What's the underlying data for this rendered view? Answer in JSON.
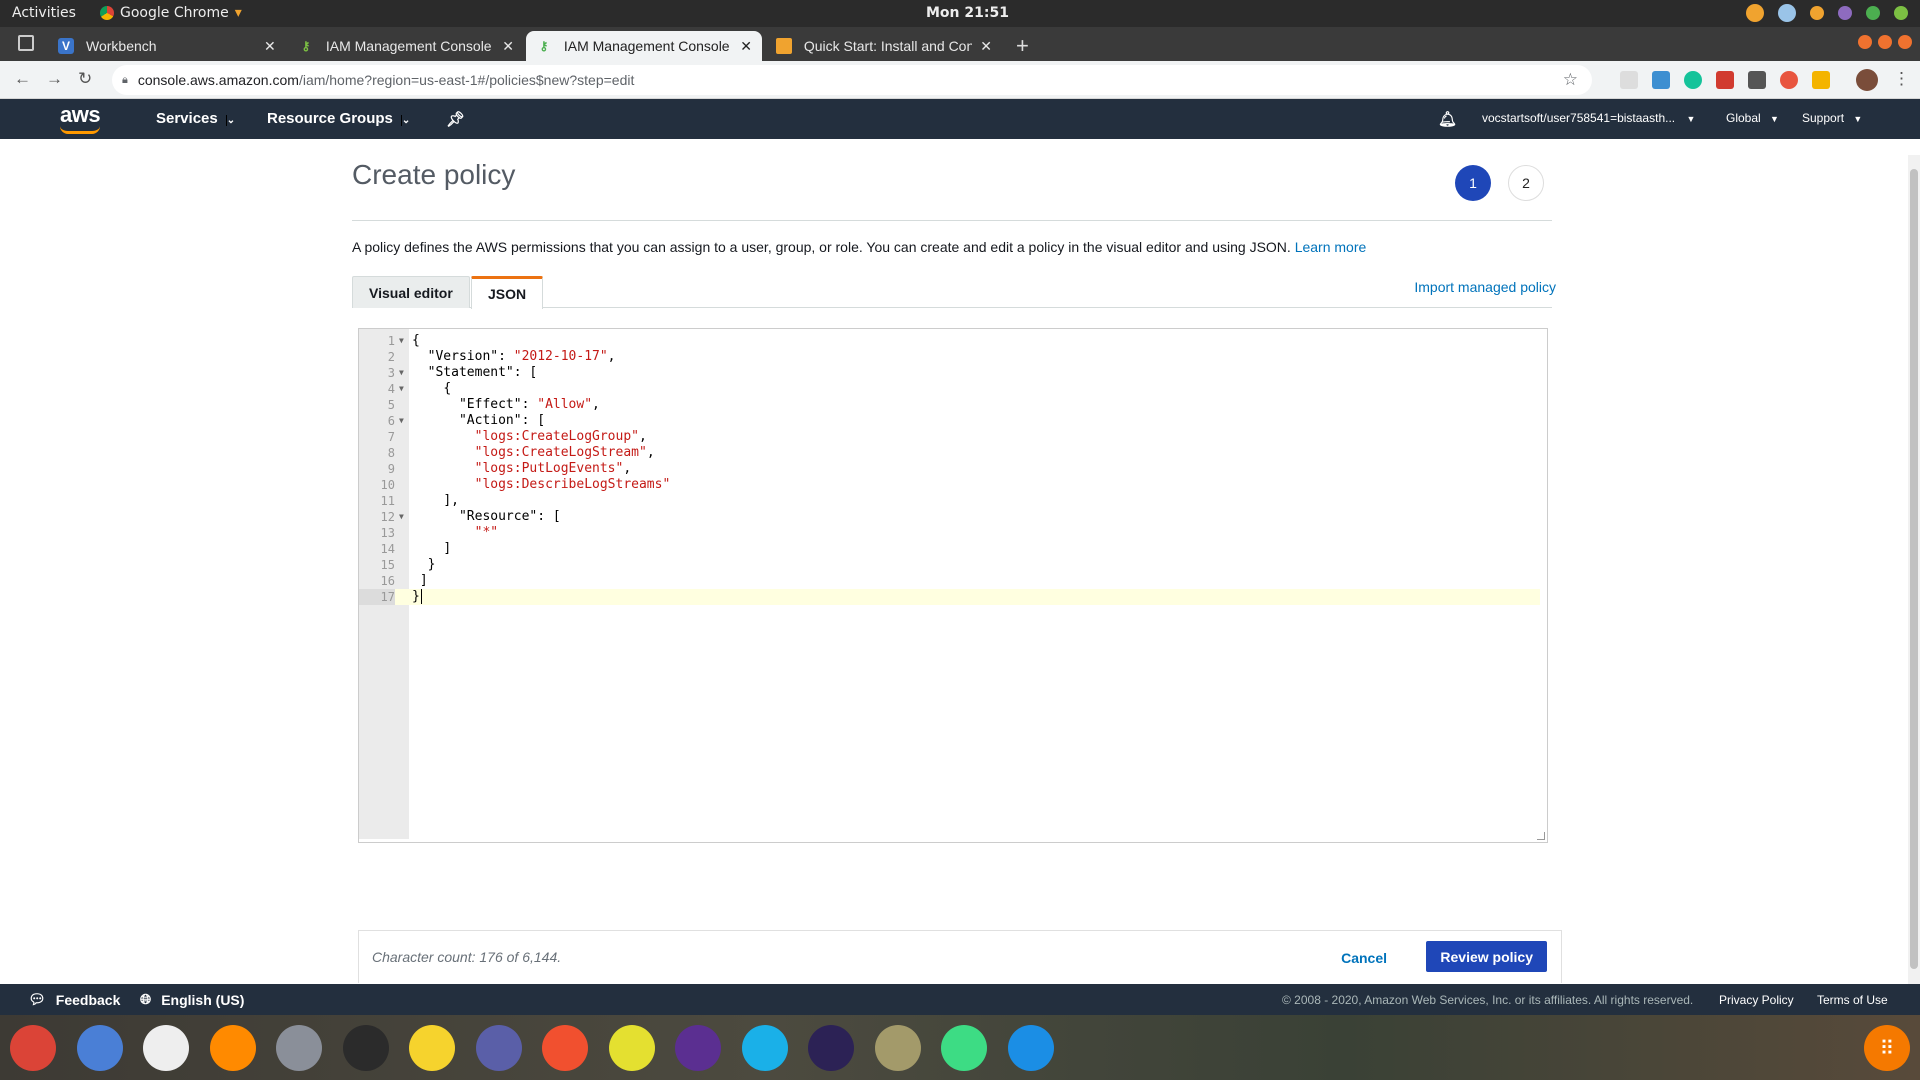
{
  "system": {
    "activities": "Activities",
    "app_name": "Google Chrome",
    "clock": "Mon 21:51"
  },
  "browser": {
    "tabs": [
      {
        "label": "Workbench",
        "favicon": "V"
      },
      {
        "label": "IAM Management Console",
        "favicon": "key"
      },
      {
        "label": "IAM Management Console",
        "favicon": "key"
      },
      {
        "label": "Quick Start: Install and Configure",
        "favicon": "box"
      }
    ],
    "url_host": "console.aws.amazon.com",
    "url_path": "/iam/home?region=us-east-1#/policies$new?step=edit"
  },
  "aws_nav": {
    "logo": "aws",
    "services": "Services",
    "resource_groups": "Resource Groups",
    "account": "vocstartsoft/user758541=bistaasth...",
    "region": "Global",
    "support": "Support"
  },
  "page": {
    "title": "Create policy",
    "steps": [
      "1",
      "2"
    ],
    "intro_text": "A policy defines the AWS permissions that you can assign to a user, group, or role. You can create and edit a policy in the visual editor and using JSON.",
    "learn_more": "Learn more",
    "tabs": {
      "visual_editor": "Visual editor",
      "json": "JSON"
    },
    "import_link": "Import managed policy"
  },
  "editor": {
    "lines": [
      {
        "n": "1",
        "fold": true,
        "indent": "",
        "parts": [
          [
            "p",
            "{"
          ]
        ]
      },
      {
        "n": "2",
        "fold": false,
        "indent": "  ",
        "parts": [
          [
            "p",
            "\"Version\": "
          ],
          [
            "s",
            "\"2012-10-17\""
          ],
          [
            "p",
            ","
          ]
        ]
      },
      {
        "n": "3",
        "fold": true,
        "indent": "  ",
        "parts": [
          [
            "p",
            "\"Statement\": ["
          ]
        ]
      },
      {
        "n": "4",
        "fold": true,
        "indent": "    ",
        "parts": [
          [
            "p",
            "{"
          ]
        ]
      },
      {
        "n": "5",
        "fold": false,
        "indent": "      ",
        "parts": [
          [
            "p",
            "\"Effect\": "
          ],
          [
            "s",
            "\"Allow\""
          ],
          [
            "p",
            ","
          ]
        ]
      },
      {
        "n": "6",
        "fold": true,
        "indent": "      ",
        "parts": [
          [
            "p",
            "\"Action\": ["
          ]
        ]
      },
      {
        "n": "7",
        "fold": false,
        "indent": "        ",
        "parts": [
          [
            "s",
            "\"logs:CreateLogGroup\""
          ],
          [
            "p",
            ","
          ]
        ]
      },
      {
        "n": "8",
        "fold": false,
        "indent": "        ",
        "parts": [
          [
            "s",
            "\"logs:CreateLogStream\""
          ],
          [
            "p",
            ","
          ]
        ]
      },
      {
        "n": "9",
        "fold": false,
        "indent": "        ",
        "parts": [
          [
            "s",
            "\"logs:PutLogEvents\""
          ],
          [
            "p",
            ","
          ]
        ]
      },
      {
        "n": "10",
        "fold": false,
        "indent": "        ",
        "parts": [
          [
            "s",
            "\"logs:DescribeLogStreams\""
          ]
        ]
      },
      {
        "n": "11",
        "fold": false,
        "indent": "    ",
        "parts": [
          [
            "p",
            "],"
          ]
        ]
      },
      {
        "n": "12",
        "fold": true,
        "indent": "      ",
        "parts": [
          [
            "p",
            "\"Resource\": ["
          ]
        ]
      },
      {
        "n": "13",
        "fold": false,
        "indent": "        ",
        "parts": [
          [
            "s",
            "\"*\""
          ]
        ]
      },
      {
        "n": "14",
        "fold": false,
        "indent": "    ",
        "parts": [
          [
            "p",
            "]"
          ]
        ]
      },
      {
        "n": "15",
        "fold": false,
        "indent": "  ",
        "parts": [
          [
            "p",
            "}"
          ]
        ]
      },
      {
        "n": "16",
        "fold": false,
        "indent": " ",
        "parts": [
          [
            "p",
            "]"
          ]
        ]
      },
      {
        "n": "17",
        "fold": false,
        "indent": "",
        "parts": [
          [
            "p",
            "}"
          ]
        ]
      }
    ],
    "active_line": 17
  },
  "footer_actions": {
    "char_count": "Character count: 176 of 6,144.",
    "cancel": "Cancel",
    "review": "Review policy"
  },
  "aws_footer": {
    "feedback": "Feedback",
    "language": "English (US)",
    "copyright": "© 2008 - 2020, Amazon Web Services, Inc. or its affiliates. All rights reserved.",
    "privacy": "Privacy Policy",
    "terms": "Terms of Use"
  },
  "colors": {
    "aws_navy": "#232f3e",
    "aws_orange": "#ff9900",
    "primary_blue": "#1f47b8",
    "link_blue": "#0073bb",
    "json_string": "#c41a16"
  },
  "dock": [
    {
      "name": "chrome-icon",
      "color": "#db4437"
    },
    {
      "name": "chromium-icon",
      "color": "#4a7fd6"
    },
    {
      "name": "calendar-icon",
      "color": "#eeeeee"
    },
    {
      "name": "firefox-icon",
      "color": "#ff8a00"
    },
    {
      "name": "files-icon",
      "color": "#8a8f99"
    },
    {
      "name": "terminal-icon",
      "color": "#2b2b2b"
    },
    {
      "name": "music-icon",
      "color": "#f6d32d"
    },
    {
      "name": "documents-icon",
      "color": "#5a5fa8"
    },
    {
      "name": "download-icon",
      "color": "#f1502f"
    },
    {
      "name": "help-icon",
      "color": "#e4e030"
    },
    {
      "name": "mail-icon",
      "color": "#5b2f91"
    },
    {
      "name": "webcam-icon",
      "color": "#1ab0e8"
    },
    {
      "name": "eclipse-icon",
      "color": "#2c2255"
    },
    {
      "name": "archive-icon",
      "color": "#a39a6a"
    },
    {
      "name": "android-studio-icon",
      "color": "#3ddc84"
    },
    {
      "name": "vscode-icon",
      "color": "#1b8ee5"
    }
  ]
}
